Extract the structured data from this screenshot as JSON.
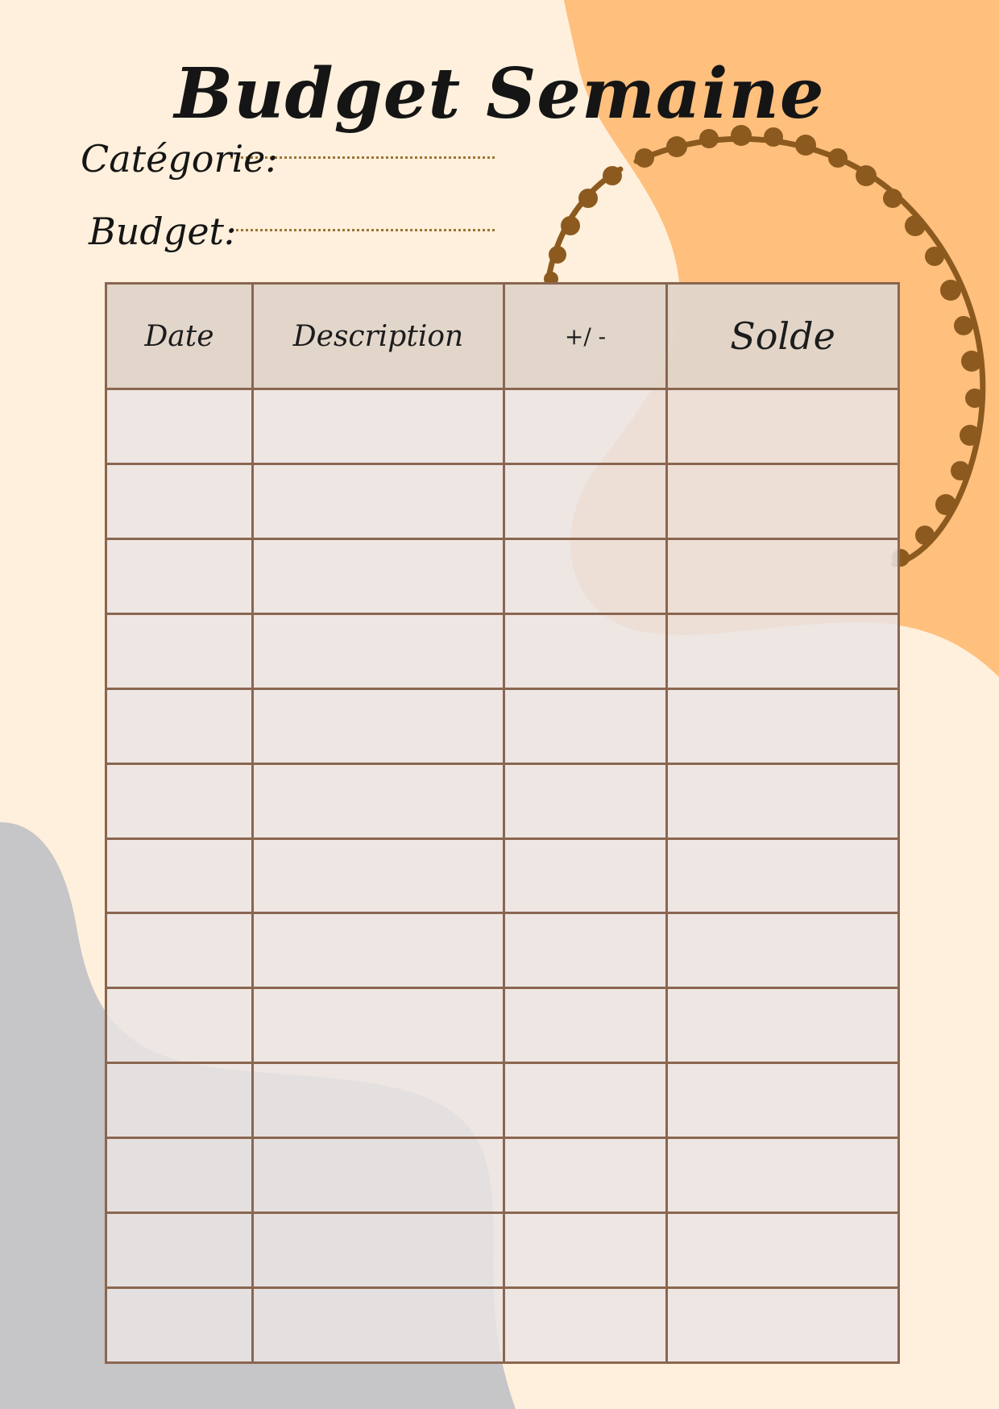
{
  "title": "Budget Semaine",
  "fields": {
    "category_label": "Catégorie:",
    "budget_label": "Budget:"
  },
  "table": {
    "headers": [
      "Date",
      "Description",
      "+/ -",
      "Solde"
    ],
    "row_count": 13
  },
  "colors": {
    "background": "#FEF0DC",
    "orange_accent": "#FFBF7D",
    "gray_accent": "#C6C5C7",
    "wreath": "#8C5A1E",
    "table_border": "#8A6650",
    "header_fill": "#E0D4C6",
    "cell_fill": "#EEE8E6",
    "dotted_line": "#9C7434"
  }
}
